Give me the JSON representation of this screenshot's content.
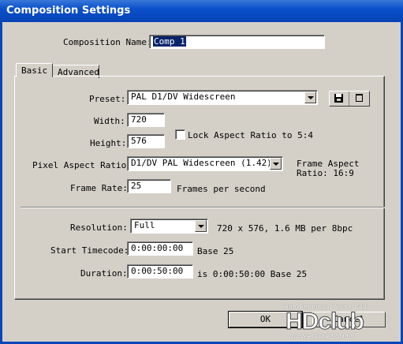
{
  "window": {
    "title": "Composition Settings"
  },
  "comp_name": {
    "label": "Composition Name:",
    "value": "Comp 1"
  },
  "tabs": [
    {
      "label": "Basic"
    },
    {
      "label": "Advanced"
    }
  ],
  "preset": {
    "label": "Preset:",
    "value": "PAL D1/DV Widescreen",
    "save_icon": "floppy-disk-icon",
    "delete_icon": "trash-icon"
  },
  "width": {
    "label": "Width:",
    "value": "720"
  },
  "height": {
    "label": "Height:",
    "value": "576"
  },
  "lock_aspect": {
    "label": "Lock Aspect Ratio to 5:4",
    "checked": false
  },
  "pixel_aspect": {
    "label": "Pixel Aspect Ratio:",
    "value": "D1/DV PAL Widescreen (1.42)",
    "frame_aspect_line1": "Frame Aspect",
    "frame_aspect_line2": "Ratio: 16:9"
  },
  "frame_rate": {
    "label": "Frame Rate:",
    "value": "25",
    "unit": "Frames per second"
  },
  "resolution": {
    "label": "Resolution:",
    "value": "Full",
    "info": "720 x 576, 1.6 MB per 8bpc"
  },
  "start_timecode": {
    "label": "Start Timecode:",
    "value": "0:00:00:00",
    "base": "Base 25"
  },
  "duration": {
    "label": "Duration:",
    "value": "0:00:50:00",
    "info": "is 0:00:50:00  Base 25"
  },
  "buttons": {
    "ok": "OK",
    "cancel": "Cancel"
  },
  "watermark": {
    "tagline": "High Definition Vision Club",
    "logo": "HDclub",
    "url": "WWW.HDCLUB.COM.TW"
  }
}
